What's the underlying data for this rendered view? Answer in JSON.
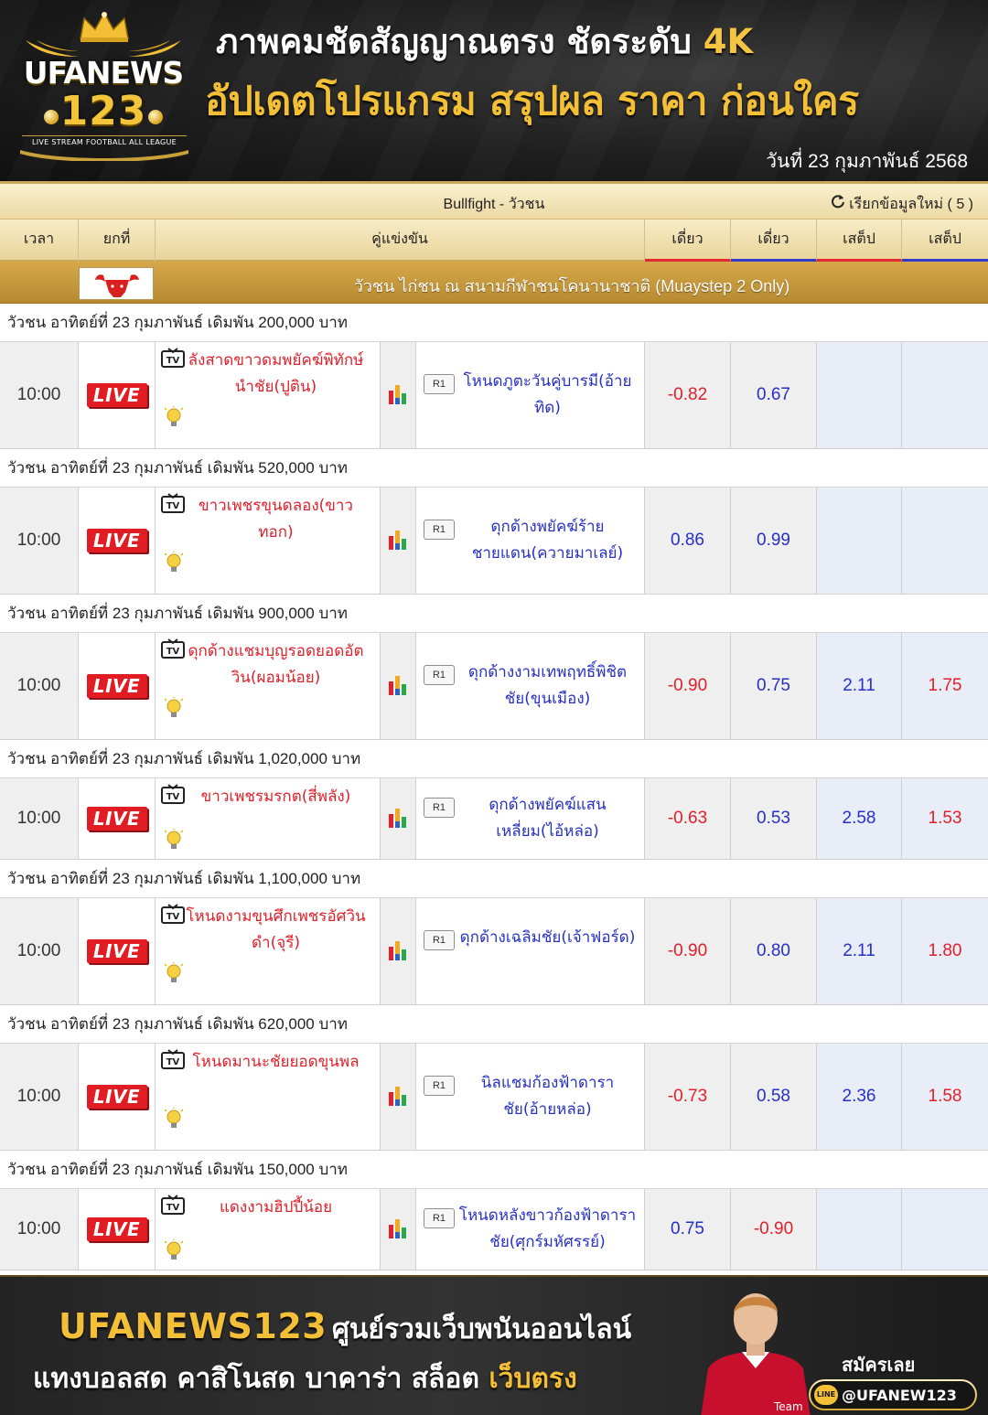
{
  "header": {
    "brand_top": "UFANEWS",
    "brand_num": "123",
    "brand_tagline": "LIVE STREAM FOOTBALL ALL LEAGUE",
    "headline1": "ภาพคมชัดสัญญาณตรง ชัดระดับ",
    "headline1_accent": "4K",
    "headline2": "อัปเดตโปรแกรม สรุปผล ราคา ก่อนใคร",
    "date": "วันที่ 23 กุมภาพันธ์ 2568"
  },
  "board": {
    "title": "Bullfight - วัวชน",
    "refresh_label": "เรียกข้อมูลใหม่ ( 5 )",
    "columns": {
      "time": "เวลา",
      "round": "ยกที่",
      "match": "คู่แข่งขัน",
      "odds1": "เดี่ยว",
      "odds2": "เดี่ยว",
      "odds3": "เสต็ป",
      "odds4": "เสต็ป"
    },
    "league_name": "วัวชน ไก่ชน ณ สนามกีฬาชนโคนานาชาติ (Muaystep 2 Only)",
    "live_label": "LIVE",
    "round_label": "R1",
    "matches": [
      {
        "section": "วัวชน อาทิตย์ที่ 23 กุมภาพันธ์ เดิมพัน 200,000 บาท",
        "time": "10:00",
        "home": "ลังสาดขาวดมพยัคฆ์พิทักษ์นำชัย(ปูติน)",
        "away": "โหนดภูตะวันคู่บารมี(อ้ายทิด)",
        "o1": "-0.82",
        "o2": "0.67",
        "o3": "",
        "o4": ""
      },
      {
        "section": "วัวชน อาทิตย์ที่ 23 กุมภาพันธ์ เดิมพัน 520,000 บาท",
        "time": "10:00",
        "home": "ขาวเพชรขุนดลอง(ขาวทอก)",
        "away": "ดุกด้างพยัคฆ์ร้ายชายแดน(ควายมาเลย์)",
        "o1": "0.86",
        "o2": "0.99",
        "o3": "",
        "o4": ""
      },
      {
        "section": "วัวชน อาทิตย์ที่ 23 กุมภาพันธ์ เดิมพัน 900,000 บาท",
        "time": "10:00",
        "home": "ดุกด้างแชมบุญรอดยอดอัตวิน(ผอมน้อย)",
        "away": "ดุกด้างงามเทพฤทธิ์พิชิตชัย(ขุนเมือง)",
        "o1": "-0.90",
        "o2": "0.75",
        "o3": "2.11",
        "o4": "1.75"
      },
      {
        "section": "วัวชน อาทิตย์ที่ 23 กุมภาพันธ์ เดิมพัน 1,020,000 บาท",
        "time": "10:00",
        "home": "ขาวเพชรมรกต(สี่พลัง)",
        "away": "ดุกด้างพยัคฆ์แสนเหลี่ยม(ไอ้หล่อ)",
        "o1": "-0.63",
        "o2": "0.53",
        "o3": "2.58",
        "o4": "1.53"
      },
      {
        "section": "วัวชน อาทิตย์ที่ 23 กุมภาพันธ์ เดิมพัน 1,100,000 บาท",
        "time": "10:00",
        "home": "โหนดงามขุนศึกเพชรอัศวินดำ(จุรี)",
        "away": "ดุกด้างเฉลิมชัย(เจ้าฟอร์ด)",
        "o1": "-0.90",
        "o2": "0.80",
        "o3": "2.11",
        "o4": "1.80"
      },
      {
        "section": "วัวชน อาทิตย์ที่ 23 กุมภาพันธ์ เดิมพัน 620,000 บาท",
        "time": "10:00",
        "home": "โหนดมานะชัยยอดขุนพล",
        "away": "นิลแชมก้องฟ้าดาราชัย(อ้ายหล่อ)",
        "o1": "-0.73",
        "o2": "0.58",
        "o3": "2.36",
        "o4": "1.58"
      },
      {
        "section": "วัวชน อาทิตย์ที่ 23 กุมภาพันธ์ เดิมพัน 150,000 บาท",
        "time": "10:00",
        "home": "แดงงามฮิปปี้น้อย",
        "away": "โหนดหลังขาวก้องฟ้าดาราชัย(ศุกร์มหัศรรย์)",
        "o1": "0.75",
        "o2": "-0.90",
        "o3": "",
        "o4": ""
      }
    ]
  },
  "footer": {
    "brand": "UFANEWS123",
    "line1_rest": "ศูนย์รวมเว็บพนันออนไลน์",
    "line2": "แทงบอลสด คาสิโนสด บาคาร่า สล็อต",
    "line2_accent": "เว็บตรง",
    "signup": "สมัครเลย",
    "line_id": "@UFANEW123",
    "line_badge": "LINE"
  },
  "colors": {
    "accent_gold": "#f2bf36",
    "live_red": "#e21c23",
    "odds_negative": "#e0202a",
    "odds_positive": "#2630c6"
  },
  "icons": [
    "crown-icon",
    "refresh-icon",
    "bull-icon",
    "tv-icon",
    "bulb-icon",
    "stats-icon",
    "line-icon"
  ]
}
